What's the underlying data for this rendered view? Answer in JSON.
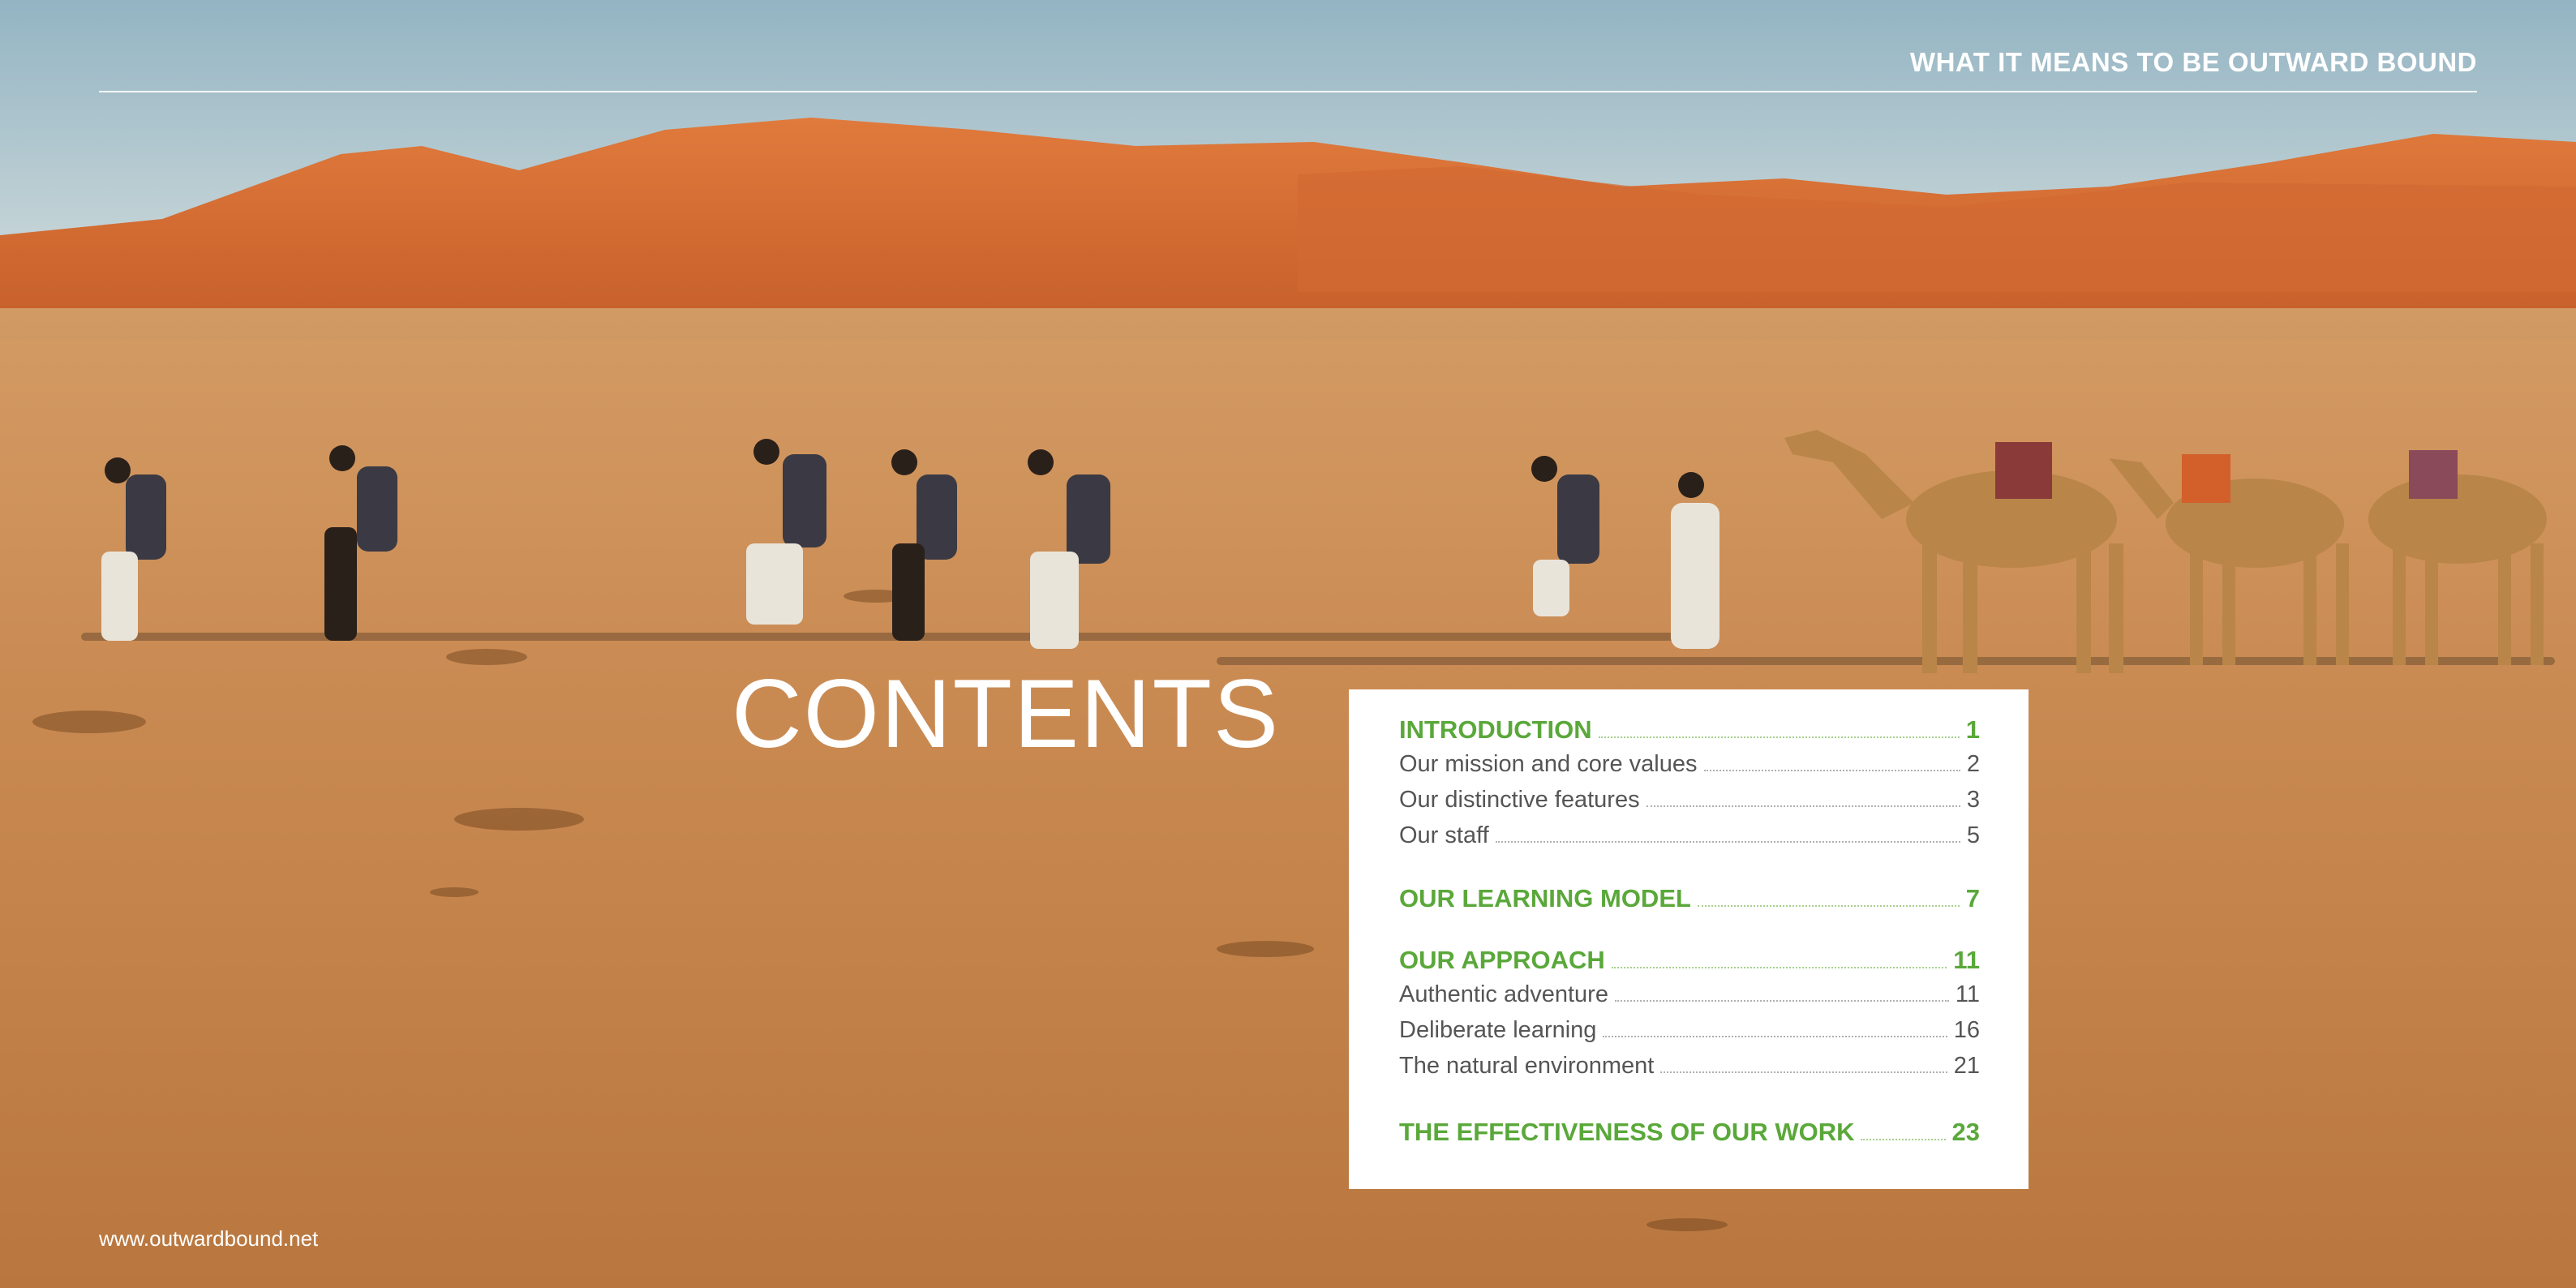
{
  "header": {
    "title": "WHAT IT MEANS TO BE OUTWARD BOUND"
  },
  "contents": {
    "heading": "CONTENTS",
    "sections": [
      {
        "title": "INTRODUCTION",
        "page": "1",
        "items": [
          {
            "label": "Our mission and core values",
            "page": "2"
          },
          {
            "label": "Our distinctive features",
            "page": "3"
          },
          {
            "label": "Our staff",
            "page": "5"
          }
        ]
      },
      {
        "title": "OUR LEARNING MODEL",
        "page": "7",
        "items": []
      },
      {
        "title": "OUR APPROACH",
        "page": "11",
        "items": [
          {
            "label": "Authentic adventure",
            "page": "11"
          },
          {
            "label": "Deliberate learning",
            "page": "16"
          },
          {
            "label": "The natural environment",
            "page": "21"
          }
        ]
      },
      {
        "title": "THE EFFECTIVENESS OF OUR WORK",
        "page": "23",
        "items": []
      }
    ]
  },
  "footer": {
    "url": "www.outwardbound.net"
  },
  "colors": {
    "accent": "#5aa83a",
    "sand": "#c98a52",
    "dunes": "#d9743a",
    "sky": "#a9c3cf"
  }
}
